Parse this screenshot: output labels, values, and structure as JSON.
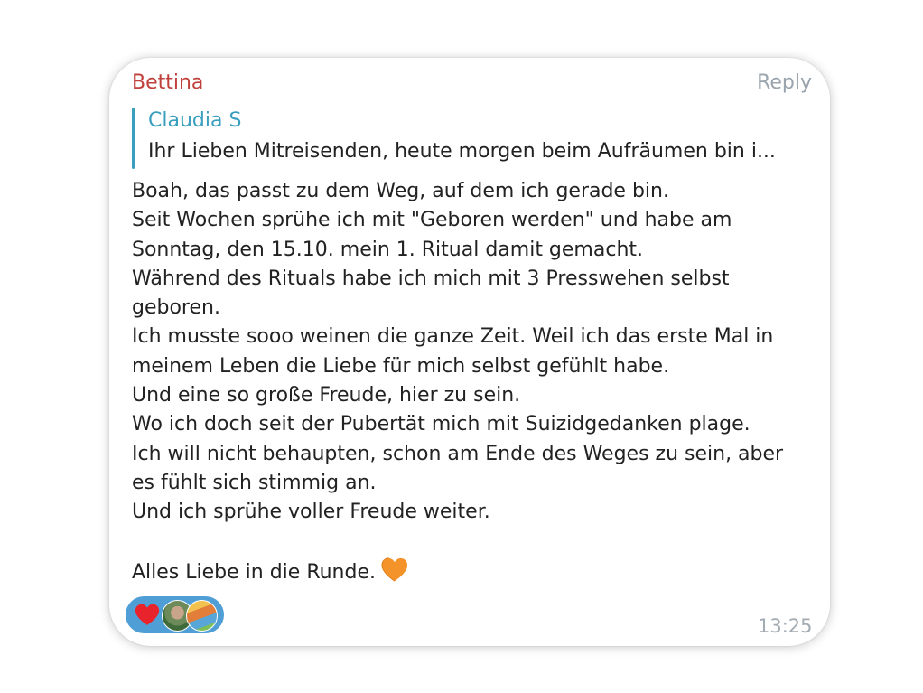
{
  "message": {
    "sender": "Bettina",
    "reply_label": "Reply",
    "quote": {
      "author": "Claudia S",
      "text": "Ihr Lieben Mitreisenden, heute morgen beim Aufräumen bin i..."
    },
    "lines": [
      "Boah, das passt zu dem Weg, auf dem ich gerade bin.",
      "Seit Wochen sprühe ich mit \"Geboren werden\" und habe am",
      "Sonntag, den 15.10. mein 1. Ritual damit gemacht.",
      "Während des Rituals habe ich mich mit 3 Presswehen selbst",
      "geboren.",
      "Ich musste sooo weinen die ganze Zeit. Weil ich das erste Mal in",
      "meinem Leben die Liebe für mich selbst gefühlt habe.",
      "Und eine so große Freude, hier zu sein.",
      "Wo ich doch seit der Pubertät mich mit Suizidgedanken plage.",
      "Ich will nicht behaupten, schon am Ende des Weges zu sein, aber",
      "es fühlt sich stimmig an.",
      "Und ich sprühe voller Freude weiter."
    ],
    "closing": "Alles Liebe in die Runde.",
    "closing_emoji": "orange-heart-icon",
    "time": "13:25"
  },
  "reactions": {
    "emoji": "red-heart-icon",
    "avatars": [
      "avatar-user-1",
      "avatar-user-2"
    ]
  },
  "colors": {
    "sender": "#c0413b",
    "quote_accent": "#3a9fbf",
    "reaction_bg": "#4f9fd6",
    "muted": "#9aa4ad"
  }
}
